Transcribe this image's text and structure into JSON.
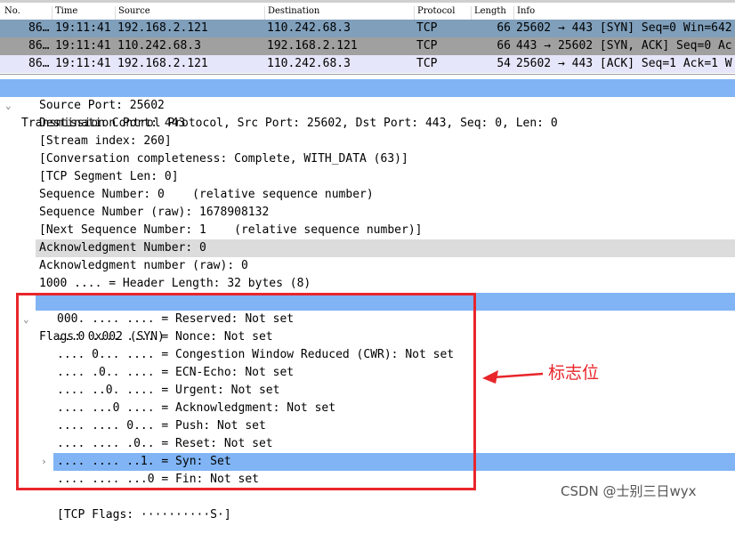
{
  "packet_list": {
    "columns": [
      "No.",
      "Time",
      "Source",
      "Destination",
      "Protocol",
      "Length",
      "Info"
    ],
    "rows": [
      {
        "no": "86…",
        "time": "19:11:41",
        "source": "192.168.2.121",
        "destination": "110.242.68.3",
        "protocol": "TCP",
        "length": "66",
        "info": "25602 → 443 [SYN] Seq=0 Win=642",
        "color": "#7f9fbb"
      },
      {
        "no": "86…",
        "time": "19:11:41",
        "source": "110.242.68.3",
        "destination": "192.168.2.121",
        "protocol": "TCP",
        "length": "66",
        "info": "443 → 25602 [SYN, ACK] Seq=0 Ac",
        "color": "#a0a0a0"
      },
      {
        "no": "86…",
        "time": "19:11:41",
        "source": "192.168.2.121",
        "destination": "110.242.68.3",
        "protocol": "TCP",
        "length": "54",
        "info": "25602 → 443 [ACK] Seq=1 Ack=1 W",
        "color": "#e6e6fa"
      }
    ]
  },
  "details": {
    "tcp": "Transmission Control Protocol, Src Port: 25602, Dst Port: 443, Seq: 0, Len: 0",
    "fields": [
      "Source Port: 25602",
      "Destination Port: 443",
      "[Stream index: 260]",
      "[Conversation completeness: Complete, WITH_DATA (63)]",
      "[TCP Segment Len: 0]",
      "Sequence Number: 0    (relative sequence number)",
      "Sequence Number (raw): 1678908132",
      "[Next Sequence Number: 1    (relative sequence number)]",
      "Acknowledgment Number: 0",
      "Acknowledgment number (raw): 0",
      "1000 .... = Header Length: 32 bytes (8)"
    ],
    "flags": "Flags: 0x002 (SYN)",
    "flag_items": [
      "000. .... .... = Reserved: Not set",
      "...0 .... .... = Nonce: Not set",
      ".... 0... .... = Congestion Window Reduced (CWR): Not set",
      ".... .0.. .... = ECN-Echo: Not set",
      ".... ..0. .... = Urgent: Not set",
      ".... ...0 .... = Acknowledgment: Not set",
      ".... .... 0... = Push: Not set",
      ".... .... .0.. = Reset: Not set",
      ".... .... ..1. = Syn: Set",
      ".... .... ...0 = Fin: Not set"
    ],
    "tcp_flags": "[TCP Flags: ··········S·]"
  },
  "annotation": {
    "label": "标志位",
    "color": "#e8262b"
  },
  "watermark": "CSDN @士别三日wyx"
}
